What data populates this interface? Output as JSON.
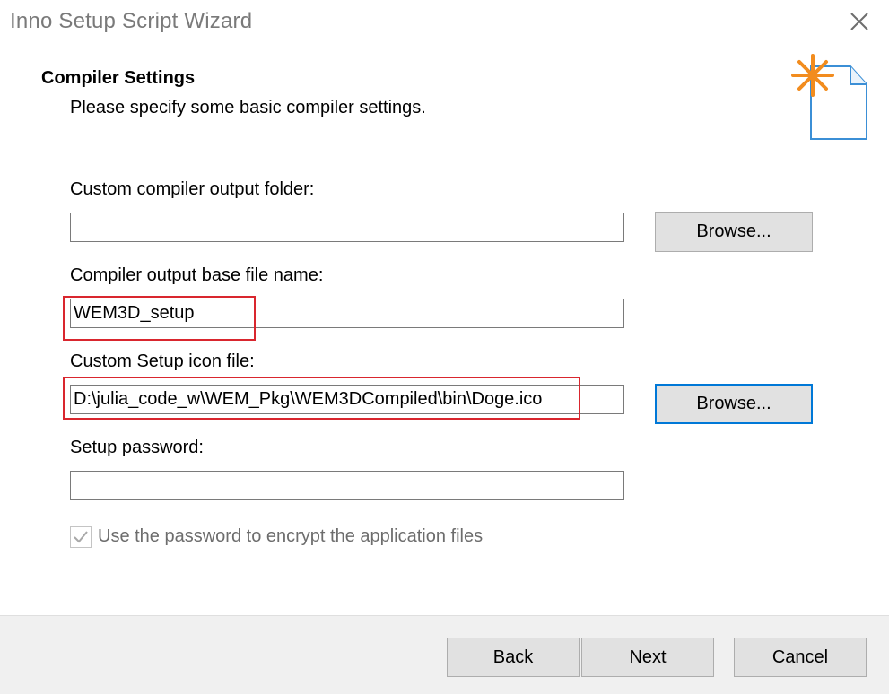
{
  "window": {
    "title": "Inno Setup Script Wizard"
  },
  "header": {
    "title": "Compiler Settings",
    "subtitle": "Please specify some basic compiler settings."
  },
  "form": {
    "output_folder": {
      "label": "Custom compiler output folder:",
      "value": "",
      "browse_label": "Browse..."
    },
    "base_name": {
      "label": "Compiler output base file name:",
      "value": "WEM3D_setup"
    },
    "icon_file": {
      "label": "Custom Setup icon file:",
      "value": "D:\\julia_code_w\\WEM_Pkg\\WEM3DCompiled\\bin\\Doge.ico",
      "browse_label": "Browse..."
    },
    "password": {
      "label": "Setup password:",
      "value": ""
    },
    "encrypt": {
      "label": "Use the password to encrypt the application files",
      "checked": true,
      "enabled": false
    }
  },
  "footer": {
    "back_label": "Back",
    "next_label": "Next",
    "cancel_label": "Cancel"
  },
  "colors": {
    "highlight": "#d9262e",
    "focus": "#0078d7",
    "icon_accent": "#f28c1e",
    "icon_outline": "#3b8fd6"
  }
}
